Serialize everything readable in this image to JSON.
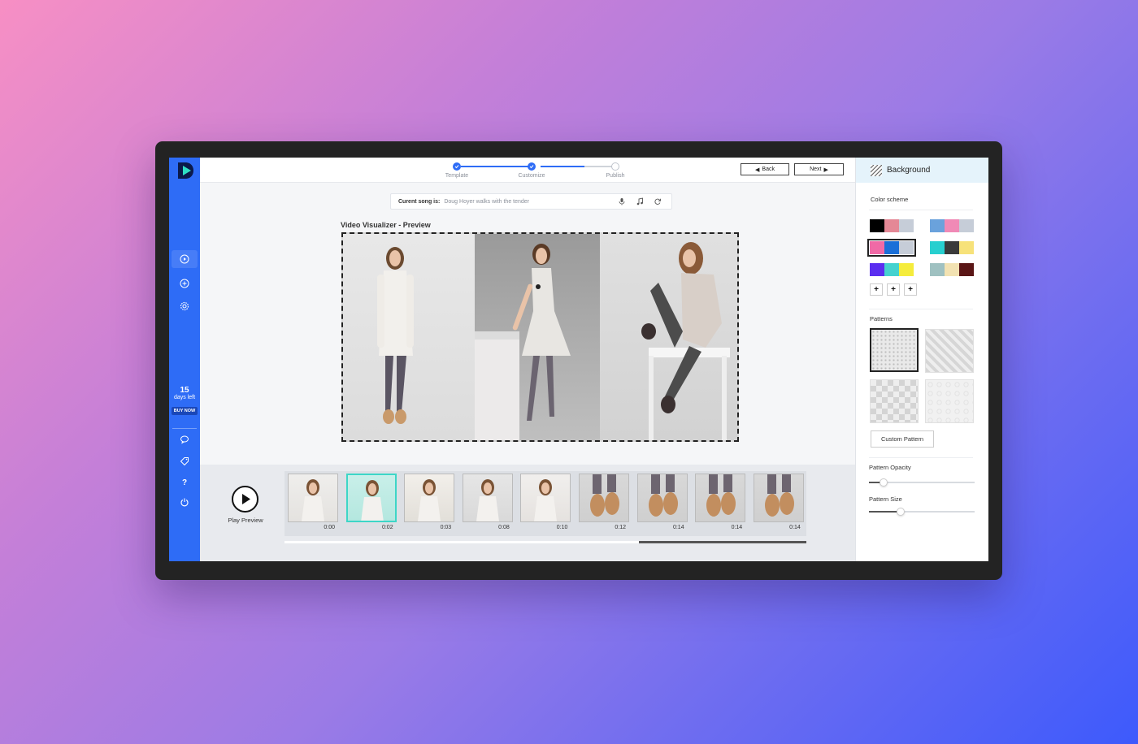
{
  "stepper": {
    "steps": [
      {
        "label": "Template",
        "state": "done"
      },
      {
        "label": "Customize",
        "state": "done"
      },
      {
        "label": "Publish",
        "state": "pending"
      }
    ],
    "back_label": "Back",
    "next_label": "Next"
  },
  "sidebar": {
    "icons": [
      "play-icon",
      "add-circle-icon",
      "gear-icon",
      "chat-icon",
      "tag-icon",
      "help-icon",
      "power-icon"
    ],
    "trial_days": "15",
    "trial_label": "days left",
    "buy_label": "BUY NOW",
    "help_glyph": "?"
  },
  "song": {
    "prefix": "Curent song is:",
    "title": "Doug Hoyer walks with the tender",
    "icons": [
      "microphone-icon",
      "music-note-icon",
      "refresh-icon"
    ]
  },
  "preview": {
    "title": "Video Visualizer - Preview"
  },
  "timeline": {
    "play_label": "Play Preview",
    "frames": [
      {
        "time": "0:00"
      },
      {
        "time": "0:02"
      },
      {
        "time": "0:03"
      },
      {
        "time": "0:08"
      },
      {
        "time": "0:10"
      },
      {
        "time": "0:12"
      },
      {
        "time": "0:14"
      },
      {
        "time": "0:14"
      },
      {
        "time": "0:14"
      }
    ],
    "selected_index": 1
  },
  "panel": {
    "title": "Background",
    "color_scheme_label": "Color scheme",
    "swatches": [
      [
        "#000000",
        "#e48896",
        "#c6cdd8"
      ],
      [
        "#6aa2dc",
        "#f08ab6",
        "#c6cdd8"
      ],
      [
        "#f06aa6",
        "#1a6fd8",
        "#c6cdd8"
      ],
      [
        "#27cfcf",
        "#3a3a3a",
        "#f7e27a"
      ],
      [
        "#5b2ef0",
        "#45d2cf",
        "#f5ec3c"
      ],
      [
        "#9fc1c1",
        "#f2e2b2",
        "#5a1616"
      ]
    ],
    "selected_swatch": 2,
    "add_label": "+",
    "patterns_label": "Patterns",
    "custom_pattern_label": "Custom Pattern",
    "opacity_label": "Pattern Opacity",
    "opacity_value": 0.14,
    "size_label": "Pattern Size",
    "size_value": 0.3
  },
  "colors": {
    "accent": "#2e6cf6",
    "selection": "#3dd6c7"
  }
}
